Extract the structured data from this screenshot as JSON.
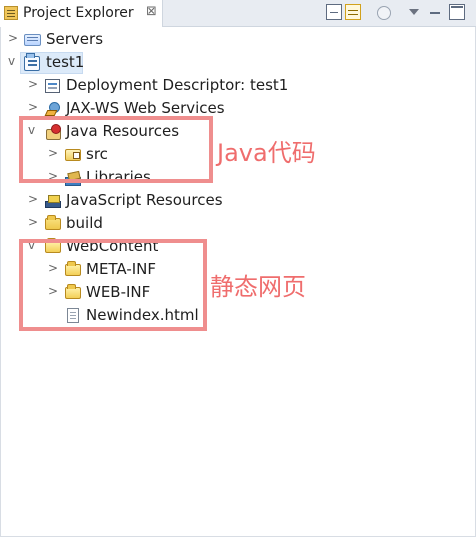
{
  "header": {
    "tab_title": "Project Explorer",
    "close_glyph": "⊠",
    "toolbar_icons": [
      "collapse-all-icon",
      "link-with-editor-icon",
      "focus-icon",
      "view-menu-icon",
      "minimize-icon",
      "maximize-icon"
    ]
  },
  "tree": {
    "items": [
      {
        "label": "Servers",
        "toggle": ">"
      },
      {
        "label": "test1",
        "toggle": "v"
      },
      {
        "label": "Deployment Descriptor: test1",
        "toggle": ">"
      },
      {
        "label": "JAX-WS Web Services",
        "toggle": ">"
      },
      {
        "label": "Java Resources",
        "toggle": "v"
      },
      {
        "label": "src",
        "toggle": ">"
      },
      {
        "label": "Libraries",
        "toggle": ">"
      },
      {
        "label": "JavaScript Resources",
        "toggle": ">"
      },
      {
        "label": "build",
        "toggle": ">"
      },
      {
        "label": "WebContent",
        "toggle": "v"
      },
      {
        "label": "META-INF",
        "toggle": ">"
      },
      {
        "label": "WEB-INF",
        "toggle": ">"
      },
      {
        "label": "Newindex.html",
        "toggle": ""
      }
    ]
  },
  "annotations": {
    "java_code": "Java代码",
    "static_pages": "静态网页",
    "color": "#ef6d6d"
  }
}
